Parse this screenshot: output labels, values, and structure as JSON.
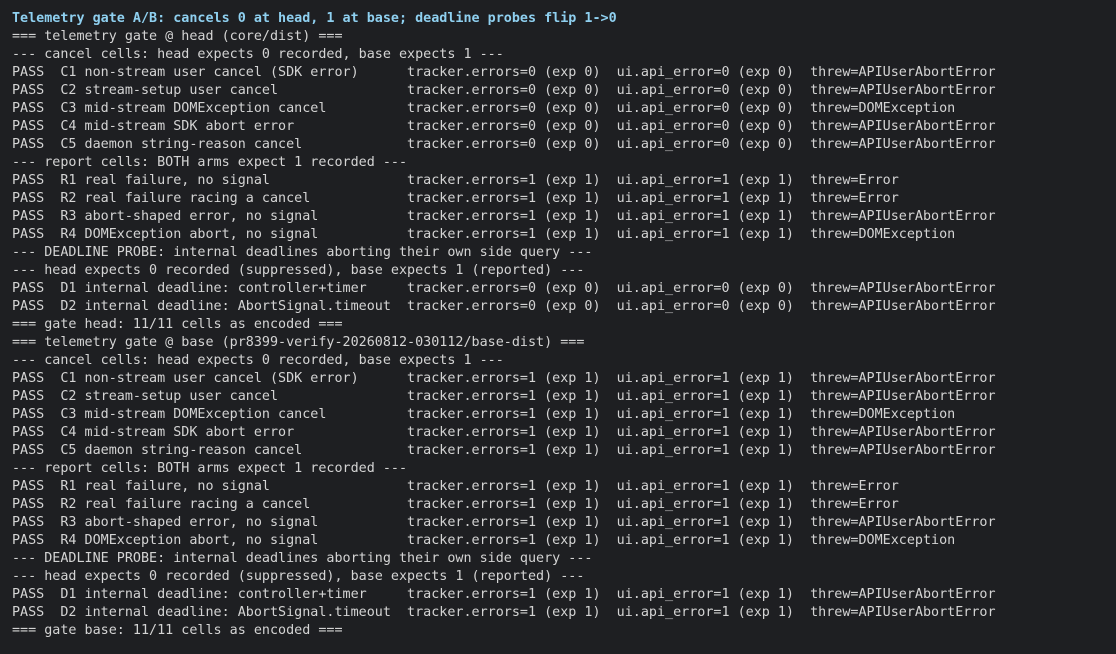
{
  "terminal": {
    "title": "Telemetry gate A/B: cancels 0 at head, 1 at base; deadline probes flip 1->0",
    "lines": [
      "=== telemetry gate @ head (core/dist) ===",
      "--- cancel cells: head expects 0 recorded, base expects 1 ---",
      "PASS  C1 non-stream user cancel (SDK error)      tracker.errors=0 (exp 0)  ui.api_error=0 (exp 0)  threw=APIUserAbortError",
      "PASS  C2 stream-setup user cancel                tracker.errors=0 (exp 0)  ui.api_error=0 (exp 0)  threw=APIUserAbortError",
      "PASS  C3 mid-stream DOMException cancel          tracker.errors=0 (exp 0)  ui.api_error=0 (exp 0)  threw=DOMException",
      "PASS  C4 mid-stream SDK abort error              tracker.errors=0 (exp 0)  ui.api_error=0 (exp 0)  threw=APIUserAbortError",
      "PASS  C5 daemon string-reason cancel             tracker.errors=0 (exp 0)  ui.api_error=0 (exp 0)  threw=APIUserAbortError",
      "--- report cells: BOTH arms expect 1 recorded ---",
      "PASS  R1 real failure, no signal                 tracker.errors=1 (exp 1)  ui.api_error=1 (exp 1)  threw=Error",
      "PASS  R2 real failure racing a cancel            tracker.errors=1 (exp 1)  ui.api_error=1 (exp 1)  threw=Error",
      "PASS  R3 abort-shaped error, no signal           tracker.errors=1 (exp 1)  ui.api_error=1 (exp 1)  threw=APIUserAbortError",
      "PASS  R4 DOMException abort, no signal           tracker.errors=1 (exp 1)  ui.api_error=1 (exp 1)  threw=DOMException",
      "--- DEADLINE PROBE: internal deadlines aborting their own side query ---",
      "--- head expects 0 recorded (suppressed), base expects 1 (reported) ---",
      "PASS  D1 internal deadline: controller+timer     tracker.errors=0 (exp 0)  ui.api_error=0 (exp 0)  threw=APIUserAbortError",
      "PASS  D2 internal deadline: AbortSignal.timeout  tracker.errors=0 (exp 0)  ui.api_error=0 (exp 0)  threw=APIUserAbortError",
      "=== gate head: 11/11 cells as encoded ===",
      "=== telemetry gate @ base (pr8399-verify-20260812-030112/base-dist) ===",
      "--- cancel cells: head expects 0 recorded, base expects 1 ---",
      "PASS  C1 non-stream user cancel (SDK error)      tracker.errors=1 (exp 1)  ui.api_error=1 (exp 1)  threw=APIUserAbortError",
      "PASS  C2 stream-setup user cancel                tracker.errors=1 (exp 1)  ui.api_error=1 (exp 1)  threw=APIUserAbortError",
      "PASS  C3 mid-stream DOMException cancel          tracker.errors=1 (exp 1)  ui.api_error=1 (exp 1)  threw=DOMException",
      "PASS  C4 mid-stream SDK abort error              tracker.errors=1 (exp 1)  ui.api_error=1 (exp 1)  threw=APIUserAbortError",
      "PASS  C5 daemon string-reason cancel             tracker.errors=1 (exp 1)  ui.api_error=1 (exp 1)  threw=APIUserAbortError",
      "--- report cells: BOTH arms expect 1 recorded ---",
      "PASS  R1 real failure, no signal                 tracker.errors=1 (exp 1)  ui.api_error=1 (exp 1)  threw=Error",
      "PASS  R2 real failure racing a cancel            tracker.errors=1 (exp 1)  ui.api_error=1 (exp 1)  threw=Error",
      "PASS  R3 abort-shaped error, no signal           tracker.errors=1 (exp 1)  ui.api_error=1 (exp 1)  threw=APIUserAbortError",
      "PASS  R4 DOMException abort, no signal           tracker.errors=1 (exp 1)  ui.api_error=1 (exp 1)  threw=DOMException",
      "--- DEADLINE PROBE: internal deadlines aborting their own side query ---",
      "--- head expects 0 recorded (suppressed), base expects 1 (reported) ---",
      "PASS  D1 internal deadline: controller+timer     tracker.errors=1 (exp 1)  ui.api_error=1 (exp 1)  threw=APIUserAbortError",
      "PASS  D2 internal deadline: AbortSignal.timeout  tracker.errors=1 (exp 1)  ui.api_error=1 (exp 1)  threw=APIUserAbortError",
      "=== gate base: 11/11 cells as encoded ==="
    ]
  },
  "colors": {
    "background": "#1e1f22",
    "text": "#d4d4d4",
    "title": "#8fd0f0"
  }
}
